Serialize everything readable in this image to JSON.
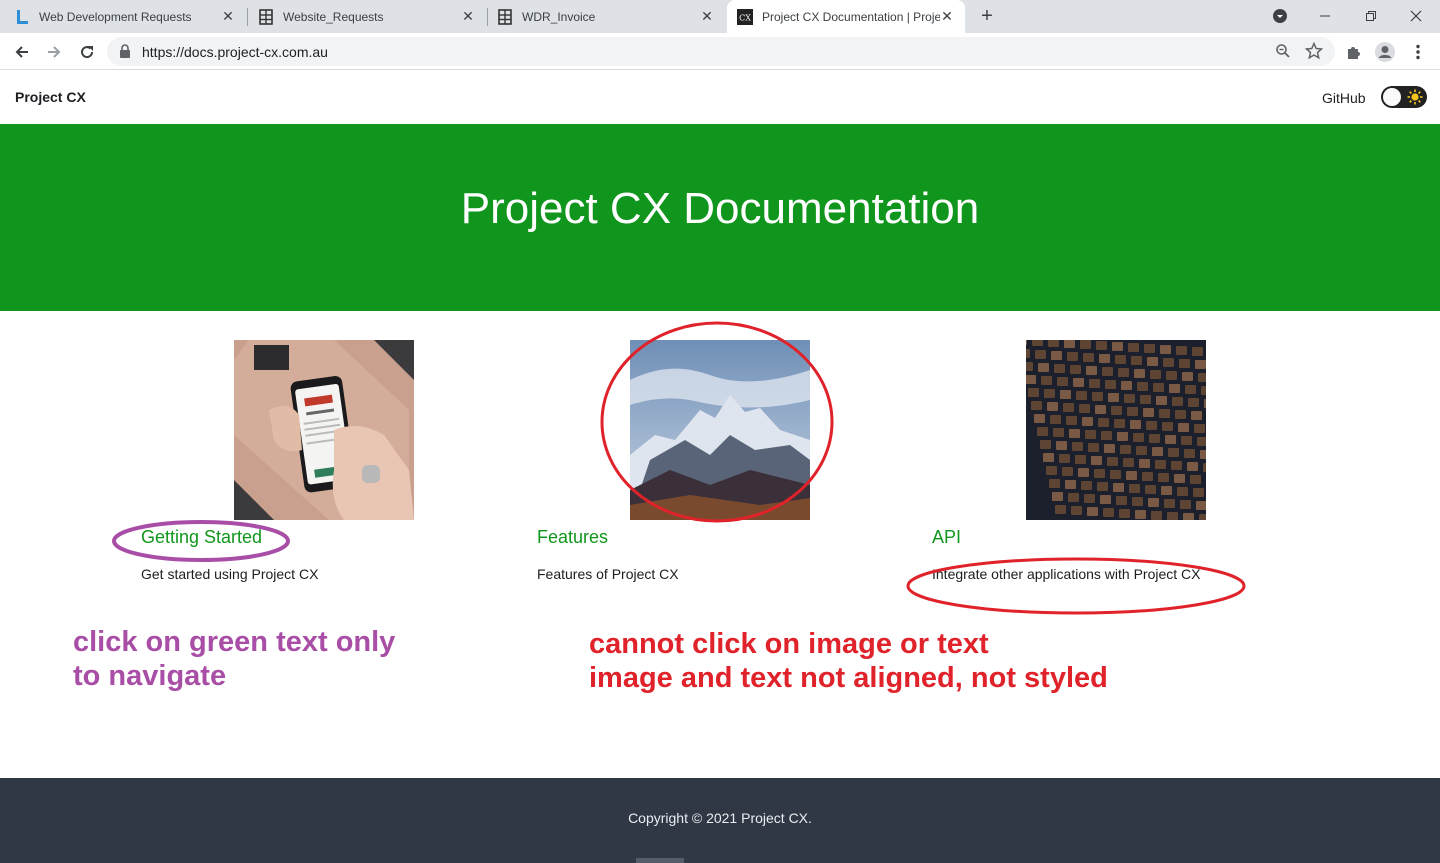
{
  "browser": {
    "tabs": [
      {
        "title": "Web Development Requests",
        "icon": "L"
      },
      {
        "title": "Website_Requests",
        "icon": "sheet-icon"
      },
      {
        "title": "WDR_Invoice",
        "icon": "sheet-icon"
      },
      {
        "title": "Project CX Documentation | Proje",
        "icon": "CX",
        "active": true
      }
    ],
    "url": "https://docs.project-cx.com.au"
  },
  "header": {
    "brand": "Project CX",
    "github": "GitHub"
  },
  "hero": {
    "title": "Project CX Documentation"
  },
  "features": [
    {
      "title": "Getting Started",
      "description": "Get started using Project CX",
      "image": "phone-in-hand"
    },
    {
      "title": "Features",
      "description": "Features of Project CX",
      "image": "snowy-mountains"
    },
    {
      "title": "API",
      "description": "Integrate other applications with Project CX",
      "image": "chip-grid"
    }
  ],
  "annotations": {
    "purple_line1": "click on green text only",
    "purple_line2": "to navigate",
    "red_line1": "cannot click on image or text",
    "red_line2": "image and text not aligned, not styled"
  },
  "footer": {
    "copyright": "Copyright © 2021 Project CX."
  },
  "colors": {
    "hero_green": "#10961c",
    "annotation_purple": "#a94ea6",
    "annotation_red": "#e0222a",
    "footer_bg": "#303846"
  }
}
